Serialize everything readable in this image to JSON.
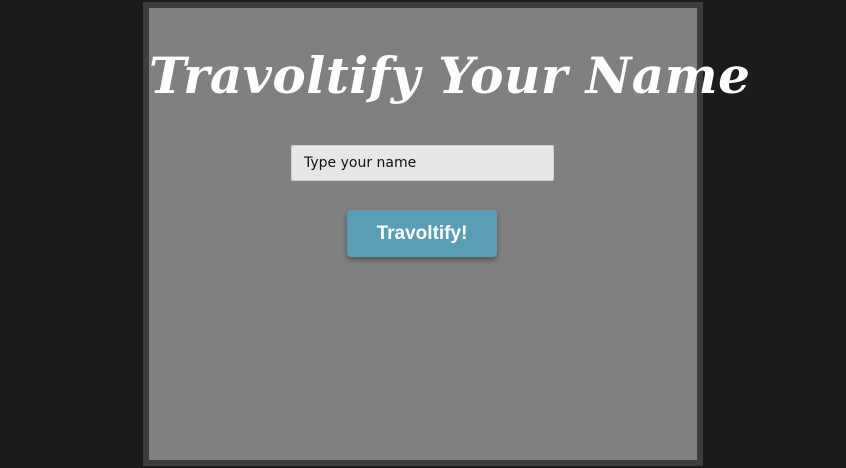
{
  "app": {
    "title": "Travoltify Your Name"
  },
  "form": {
    "name_input": {
      "value": "",
      "placeholder": "Type your name"
    },
    "submit_label": "Travoltify!"
  },
  "colors": {
    "page_background": "#1b1b1b",
    "frame_border": "#3d3d3d",
    "panel_background": "#808080",
    "input_background": "#e6e6e6",
    "button_background": "#5b9db4",
    "title_text": "#ffffff"
  }
}
